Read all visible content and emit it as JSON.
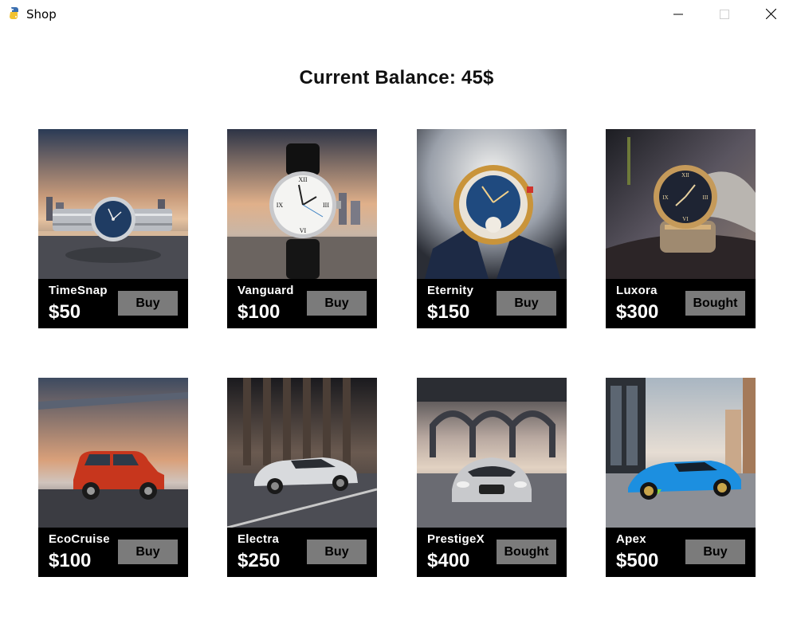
{
  "window": {
    "title": "Shop",
    "app_icon": "snake-icon",
    "controls": [
      "minimize-icon",
      "maximize-icon",
      "close-icon"
    ]
  },
  "balance": {
    "text": "Current Balance: 45$"
  },
  "products": [
    {
      "name": "TimeSnap",
      "price": "$50",
      "button": "Buy",
      "image": "watch-silver-blue-dial"
    },
    {
      "name": "Vanguard",
      "price": "$100",
      "button": "Buy",
      "image": "watch-white-dial-black-strap"
    },
    {
      "name": "Eternity",
      "price": "$150",
      "button": "Buy",
      "image": "watch-gold-blue-dial"
    },
    {
      "name": "Luxora",
      "price": "$300",
      "button": "Bought",
      "image": "watch-two-tone-black-dial"
    },
    {
      "name": "EcoCruise",
      "price": "$100",
      "button": "Buy",
      "image": "car-red-hatchback"
    },
    {
      "name": "Electra",
      "price": "$250",
      "button": "Buy",
      "image": "car-white-sports"
    },
    {
      "name": "PrestigeX",
      "price": "$400",
      "button": "Bought",
      "image": "car-silver-luxury"
    },
    {
      "name": "Apex",
      "price": "$500",
      "button": "Buy",
      "image": "car-blue-supercar"
    }
  ],
  "colors": {
    "card_background": "#000000",
    "button_background": "#7b7b7b",
    "text_on_card": "#ffffff"
  }
}
